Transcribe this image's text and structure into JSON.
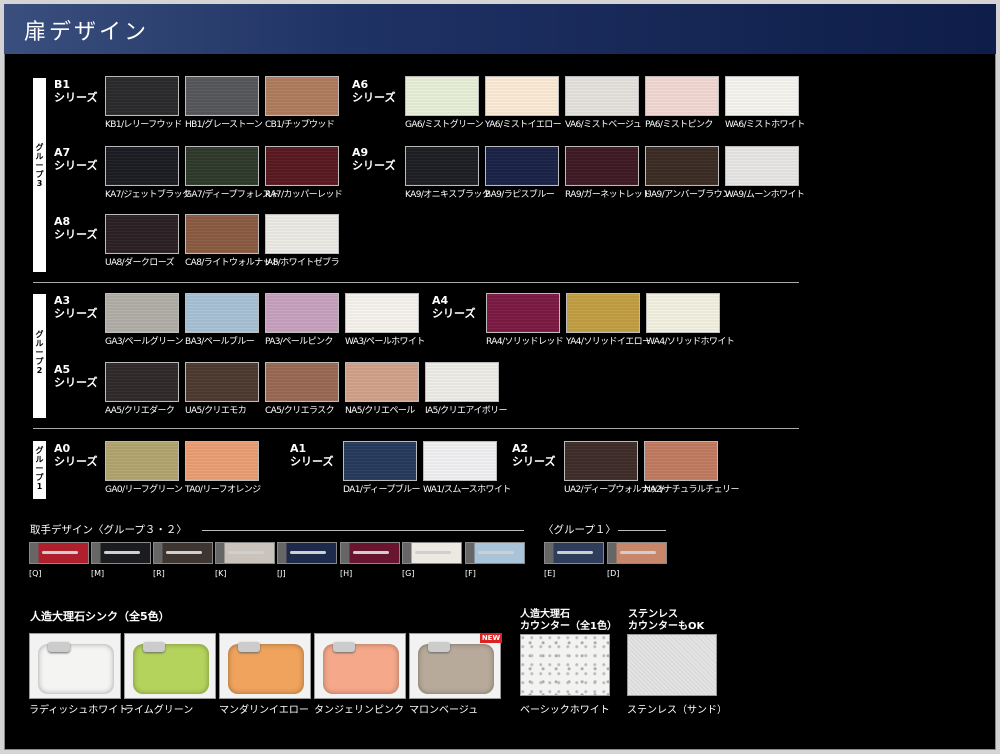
{
  "page_title": "扉デザイン",
  "groups": [
    {
      "name": "グループ3"
    },
    {
      "name": "グループ2"
    },
    {
      "name": "グループ1"
    }
  ],
  "series": [
    {
      "name": "B1\nシリーズ",
      "swatches": [
        {
          "code": "KB1/レリーフウッド",
          "color": "#2b2b2e"
        },
        {
          "code": "HB1/グレーストーン",
          "color": "#55575c"
        },
        {
          "code": "CB1/チップウッド",
          "color": "#b07c5e"
        }
      ]
    },
    {
      "name": "A6\nシリーズ",
      "swatches": [
        {
          "code": "GA6/ミストグリーン",
          "color": "#e9f0d8"
        },
        {
          "code": "YA6/ミストイエロー",
          "color": "#fcebd6"
        },
        {
          "code": "VA6/ミストベージュ",
          "color": "#e6e2de"
        },
        {
          "code": "PA6/ミストピンク",
          "color": "#f3d9d3"
        },
        {
          "code": "WA6/ミストホワイト",
          "color": "#f7f5ef"
        }
      ]
    },
    {
      "name": "A7\nシリーズ",
      "swatches": [
        {
          "code": "KA7/ジェットブラック",
          "color": "#1c1d22"
        },
        {
          "code": "GA7/ディープフォレスト",
          "color": "#2f3a2c"
        },
        {
          "code": "RA7/カッパーレッド",
          "color": "#5a1a20"
        }
      ]
    },
    {
      "name": "A9\nシリーズ",
      "swatches": [
        {
          "code": "KA9/オニキスブラック",
          "color": "#1d1f24"
        },
        {
          "code": "BA9/ラピスブルー",
          "color": "#1a2247"
        },
        {
          "code": "RA9/ガーネットレッド",
          "color": "#3f1a24"
        },
        {
          "code": "UA9/アンバーブラウン",
          "color": "#3b2c24"
        },
        {
          "code": "WA9/ムーンホワイト",
          "color": "#e9e7e6"
        }
      ]
    },
    {
      "name": "A8\nシリーズ",
      "swatches": [
        {
          "code": "UA8/ダークローズ",
          "color": "#2c2024"
        },
        {
          "code": "CA8/ライトウォルナット",
          "color": "#8b5c42"
        },
        {
          "code": "IA8/ホワイトゼブラ",
          "color": "#ecebe6"
        }
      ]
    },
    {
      "name": "A3\nシリーズ",
      "swatches": [
        {
          "code": "GA3/ペールグリーン",
          "color": "#b1afa7"
        },
        {
          "code": "BA3/ペールブルー",
          "color": "#a8c2d6"
        },
        {
          "code": "PA3/ペールピンク",
          "color": "#c8a2c0"
        },
        {
          "code": "WA3/ペールホワイト",
          "color": "#f7f4ee"
        }
      ]
    },
    {
      "name": "A4\nシリーズ",
      "swatches": [
        {
          "code": "RA4/ソリッドレッド",
          "color": "#7c1a43"
        },
        {
          "code": "YA4/ソリッドイエロー",
          "color": "#c39f44"
        },
        {
          "code": "WA4/ソリッドホワイト",
          "color": "#f4f1e1"
        }
      ]
    },
    {
      "name": "A5\nシリーズ",
      "swatches": [
        {
          "code": "AA5/クリエダーク",
          "color": "#312a2a"
        },
        {
          "code": "UA5/クリエモカ",
          "color": "#4d3a30"
        },
        {
          "code": "CA5/クリエラスク",
          "color": "#9a6a54"
        },
        {
          "code": "NA5/クリエペール",
          "color": "#d2a28a"
        },
        {
          "code": "IA5/クリエアイボリー",
          "color": "#efede8"
        }
      ]
    },
    {
      "name": "A0\nシリーズ",
      "swatches": [
        {
          "code": "GA0/リーフグリーン",
          "color": "#b2a56f"
        },
        {
          "code": "TA0/リーフオレンジ",
          "color": "#ec9f75"
        }
      ]
    },
    {
      "name": "A1\nシリーズ",
      "swatches": [
        {
          "code": "DA1/ディープブルー",
          "color": "#283a5e"
        },
        {
          "code": "WA1/スムースホワイト",
          "color": "#f1f1f3"
        }
      ]
    },
    {
      "name": "A2\nシリーズ",
      "swatches": [
        {
          "code": "UA2/ディープウォルナット",
          "color": "#3f2d2a"
        },
        {
          "code": "NA2/ナチュラルチェリー",
          "color": "#c27c62"
        }
      ]
    }
  ],
  "handles": {
    "title_group32": "取手デザイン〈グループ３・２〉",
    "title_group1": "〈グループ１〉",
    "items": [
      {
        "code": "[Q]",
        "color": "#b0202c"
      },
      {
        "code": "[M]",
        "color": "#1b1c20"
      },
      {
        "code": "[R]",
        "color": "#3e3430"
      },
      {
        "code": "[K]",
        "color": "#c9c3bb"
      },
      {
        "code": "[J]",
        "color": "#1e2a4c"
      },
      {
        "code": "[H]",
        "color": "#6a1530"
      },
      {
        "code": "[G]",
        "color": "#ece9e3"
      },
      {
        "code": "[F]",
        "color": "#a9c3d8"
      },
      {
        "code": "[E]",
        "color": "#2f3d5d"
      },
      {
        "code": "[D]",
        "color": "#c8876a"
      }
    ]
  },
  "sinks": {
    "title": "人造大理石シンク（全5色）",
    "new_badge": "NEW",
    "items": [
      {
        "label": "ラディッシュホワイト",
        "color": "#f4f4f2"
      },
      {
        "label": "ライムグリーン",
        "color": "#b4d35c"
      },
      {
        "label": "マンダリンイエロー",
        "color": "#efa35c"
      },
      {
        "label": "タンジェリンピンク",
        "color": "#f5a88a"
      },
      {
        "label": "マロンベージュ",
        "color": "#b8aa9a"
      }
    ]
  },
  "counters": [
    {
      "title": "人造大理石\nカウンター（全1色）",
      "label": "ベーシックホワイト",
      "color": "#f3f3f1"
    },
    {
      "title": "ステンレス\nカウンターもOK",
      "label": "ステンレス（サンド）",
      "color": "#e3e3e3"
    }
  ]
}
